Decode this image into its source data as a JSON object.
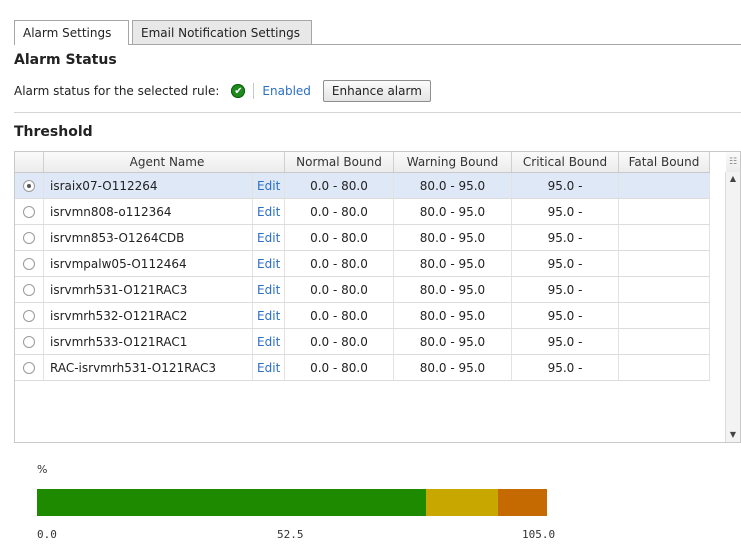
{
  "tabs": [
    {
      "label": "Alarm Settings",
      "active": true
    },
    {
      "label": "Email Notification Settings",
      "active": false
    }
  ],
  "alarm_status": {
    "title": "Alarm Status",
    "label": "Alarm status for the selected rule:",
    "status": "Enabled",
    "status_icon": "green-check-icon",
    "button": "Enhance alarm"
  },
  "threshold": {
    "title": "Threshold",
    "columns": [
      "Agent Name",
      "Normal Bound",
      "Warning Bound",
      "Critical Bound",
      "Fatal Bound"
    ],
    "rows": [
      {
        "agent": "israix07-O112264",
        "edit": "Edit",
        "normal": "0.0 - 80.0",
        "warning": "80.0 - 95.0",
        "critical": "95.0 -",
        "fatal": "",
        "selected": true
      },
      {
        "agent": "isrvmn808-o112364",
        "edit": "Edit",
        "normal": "0.0 - 80.0",
        "warning": "80.0 - 95.0",
        "critical": "95.0 -",
        "fatal": "",
        "selected": false
      },
      {
        "agent": "isrvmn853-O1264CDB",
        "edit": "Edit",
        "normal": "0.0 - 80.0",
        "warning": "80.0 - 95.0",
        "critical": "95.0 -",
        "fatal": "",
        "selected": false
      },
      {
        "agent": "isrvmpalw05-O112464",
        "edit": "Edit",
        "normal": "0.0 - 80.0",
        "warning": "80.0 - 95.0",
        "critical": "95.0 -",
        "fatal": "",
        "selected": false
      },
      {
        "agent": "isrvmrh531-O121RAC3",
        "edit": "Edit",
        "normal": "0.0 - 80.0",
        "warning": "80.0 - 95.0",
        "critical": "95.0 -",
        "fatal": "",
        "selected": false
      },
      {
        "agent": "isrvmrh532-O121RAC2",
        "edit": "Edit",
        "normal": "0.0 - 80.0",
        "warning": "80.0 - 95.0",
        "critical": "95.0 -",
        "fatal": "",
        "selected": false
      },
      {
        "agent": "isrvmrh533-O121RAC1",
        "edit": "Edit",
        "normal": "0.0 - 80.0",
        "warning": "80.0 - 95.0",
        "critical": "95.0 -",
        "fatal": "",
        "selected": false
      },
      {
        "agent": "RAC-isrvmrh531-O121RAC3",
        "edit": "Edit",
        "normal": "0.0 - 80.0",
        "warning": "80.0 - 95.0",
        "critical": "95.0 -",
        "fatal": "",
        "selected": false
      }
    ]
  },
  "range_bar": {
    "unit_label": "%",
    "min": 0.0,
    "max": 105.0,
    "ticks": [
      "0.0",
      "52.5",
      "105.0"
    ],
    "segments": [
      {
        "name": "normal",
        "from": 0.0,
        "to": 80.0,
        "color": "#1e8a00"
      },
      {
        "name": "warning",
        "from": 80.0,
        "to": 95.0,
        "color": "#c8a800"
      },
      {
        "name": "critical",
        "from": 95.0,
        "to": 105.0,
        "color": "#c46a00"
      }
    ]
  }
}
